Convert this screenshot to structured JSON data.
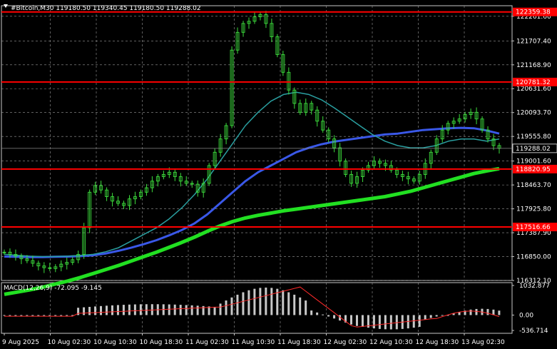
{
  "header": {
    "symbol_icon": "triangle-down-icon",
    "title": "#Bitcoin,M30  119180.50 119340.45 119180.50 119288.02"
  },
  "price_axis": {
    "labels": [
      "122261.60",
      "121707.40",
      "121168.90",
      "120631.60",
      "120093.70",
      "119555.80",
      "119001.60",
      "118463.70",
      "117925.80",
      "117387.90",
      "116850.00",
      "116312.10"
    ],
    "current_price": "119288.02"
  },
  "levels": [
    {
      "value": 122359.38,
      "label": "122359.38"
    },
    {
      "value": 120781.32,
      "label": "120781.32"
    },
    {
      "value": 118820.95,
      "label": "118820.95"
    },
    {
      "value": 117516.66,
      "label": "117516.66"
    }
  ],
  "macd": {
    "title": "MACD(12,26,9) -72.095 -9.145",
    "axis_labels": [
      "1032.877",
      "0.00",
      "-536.714"
    ]
  },
  "time_axis": [
    "9 Aug 2025",
    "10 Aug 02:30",
    "10 Aug 10:30",
    "10 Aug 18:30",
    "11 Aug 02:30",
    "11 Aug 10:30",
    "11 Aug 18:30",
    "12 Aug 02:30",
    "12 Aug 10:30",
    "12 Aug 18:30",
    "13 Aug 02:30"
  ],
  "colors": {
    "candle": "#3cdc3c",
    "grid": "#9a9a9a",
    "level": "#ff0000",
    "ma_fast": "#2a9fa0",
    "ma_mid": "#3a58e8",
    "ma_slow": "#22e022",
    "macd_hist": "#c8c8c8",
    "macd_signal": "#ff2a2a",
    "current_price_box": "#c0c0c0"
  },
  "chart_data": {
    "type": "line",
    "title": "#Bitcoin,M30",
    "ylim": [
      116312.1,
      122500
    ],
    "grid": true,
    "close": [
      116950,
      116900,
      116860,
      116800,
      116760,
      116700,
      116640,
      116600,
      116580,
      116620,
      116680,
      116720,
      116780,
      116900,
      117500,
      118300,
      118450,
      118350,
      118200,
      118100,
      118050,
      118000,
      118150,
      118200,
      118300,
      118400,
      118550,
      118650,
      118700,
      118750,
      118650,
      118550,
      118500,
      118480,
      118300,
      118500,
      118900,
      119200,
      119500,
      119800,
      121500,
      121900,
      122100,
      122150,
      122250,
      122300,
      122100,
      121800,
      121400,
      121000,
      120600,
      120300,
      120100,
      120300,
      120150,
      119900,
      119700,
      119500,
      119300,
      119000,
      118700,
      118500,
      118650,
      118800,
      118900,
      119000,
      118950,
      118900,
      118800,
      118700,
      118650,
      118600,
      118550,
      118700,
      118950,
      119200,
      119500,
      119700,
      119850,
      119900,
      119950,
      120050,
      120100,
      119950,
      119700,
      119500,
      119350,
      119290
    ],
    "ma_fast": [
      116900,
      116880,
      116860,
      116850,
      116850,
      116860,
      116880,
      116900,
      116960,
      117050,
      117200,
      117350,
      117500,
      117700,
      117950,
      118250,
      118600,
      119000,
      119400,
      119800,
      120100,
      120350,
      120500,
      120550,
      120500,
      120380,
      120200,
      120000,
      119800,
      119600,
      119450,
      119350,
      119300,
      119300,
      119350,
      119450,
      119500,
      119500,
      119450,
      119500
    ],
    "ma_mid": [
      116850,
      116845,
      116840,
      116840,
      116845,
      116850,
      116860,
      116880,
      116920,
      116980,
      117050,
      117130,
      117220,
      117330,
      117450,
      117600,
      117800,
      118050,
      118300,
      118550,
      118750,
      118900,
      119050,
      119200,
      119300,
      119380,
      119440,
      119480,
      119520,
      119560,
      119600,
      119620,
      119660,
      119700,
      119720,
      119740,
      119750,
      119740,
      119690,
      119620
    ],
    "ma_slow": [
      116000,
      116050,
      116100,
      116160,
      116230,
      116300,
      116380,
      116470,
      116560,
      116650,
      116750,
      116850,
      116950,
      117060,
      117170,
      117290,
      117420,
      117540,
      117640,
      117720,
      117780,
      117830,
      117880,
      117920,
      117960,
      118000,
      118040,
      118080,
      118120,
      118160,
      118200,
      118260,
      118320,
      118400,
      118480,
      118560,
      118640,
      118720,
      118780,
      118830
    ]
  }
}
